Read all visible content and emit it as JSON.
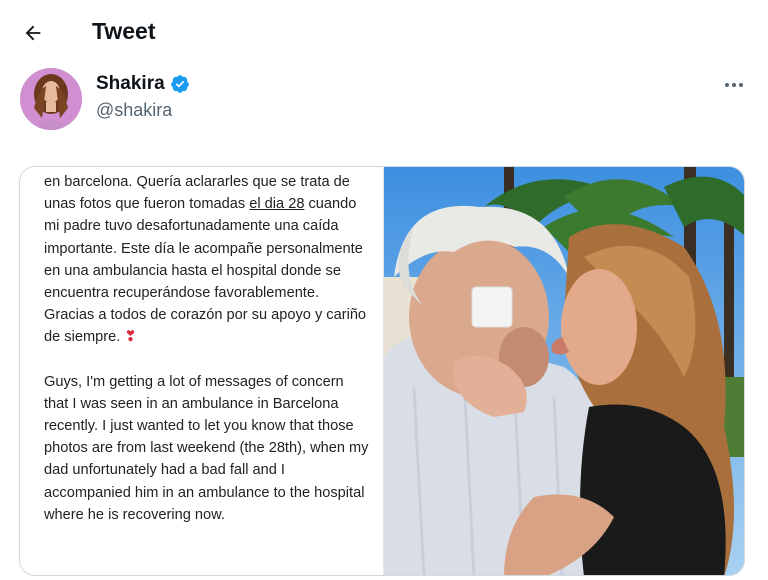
{
  "header": {
    "title": "Tweet",
    "back_icon": "arrow-left-icon"
  },
  "author": {
    "name": "Shakira",
    "handle": "@shakira",
    "verified_icon": "verified-badge-icon",
    "verified_color": "#1d9bf0"
  },
  "more_icon": "more-horizontal-icon",
  "media": {
    "spanish_text": {
      "part1": "en barcelona. Quería aclararles que se trata de unas fotos que fueron tomadas ",
      "underlined": "el dia 28",
      "part2": " cuando mi padre tuvo desafortunadamente una caída importante. Este día le acompañe personalmente en una ambulancia hasta el hospital donde se encuentra recuperándose favorablemente. Gracias a todos de corazón por su apoyo y cariño de siempre. ",
      "emoji": "❣"
    },
    "english_text": "Guys, I'm getting a lot of messages of concern that I was seen in an ambulance in Barcelona recently. I just wanted to let you know that those photos are from last weekend (the 28th), when my dad unfortunately had a bad fall and I accompanied him in an ambulance to the hospital where he is recovering now."
  },
  "colors": {
    "text_primary": "#0f1419",
    "text_secondary": "#536471",
    "border": "#cfd9de"
  }
}
